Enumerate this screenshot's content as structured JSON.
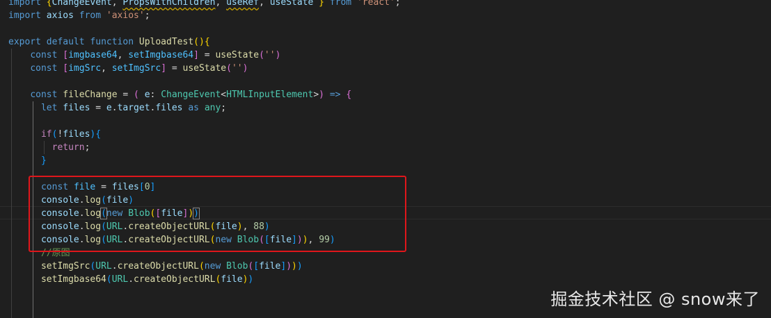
{
  "colors": {
    "background": "#1f1f1f",
    "keyword": "#569cd6",
    "control_keyword": "#c586c0",
    "function": "#dcdcaa",
    "variable": "#9cdcfe",
    "constant": "#4fc1ff",
    "type": "#4ec9b0",
    "string": "#ce9178",
    "number": "#b5cea8",
    "comment": "#6a9955",
    "annotation_box": "#e0161b"
  },
  "editor": {
    "lines": [
      [
        [
          "kw",
          "import"
        ],
        [
          "pl",
          " "
        ],
        [
          "b1",
          "{"
        ],
        [
          "var",
          "ChangeEvent"
        ],
        [
          "pl",
          ", "
        ],
        [
          "var squig",
          "PropsWithChildren"
        ],
        [
          "pl",
          ", "
        ],
        [
          "var squig",
          "useRef"
        ],
        [
          "pl",
          ", "
        ],
        [
          "var",
          "useState"
        ],
        [
          "pl",
          " "
        ],
        [
          "b1",
          "}"
        ],
        [
          "pl",
          " "
        ],
        [
          "kw",
          "from"
        ],
        [
          "pl",
          " "
        ],
        [
          "str",
          "'react'"
        ],
        [
          "pl",
          ";"
        ]
      ],
      [
        [
          "kw",
          "import"
        ],
        [
          "pl",
          " "
        ],
        [
          "var",
          "axios"
        ],
        [
          "pl",
          " "
        ],
        [
          "kw",
          "from"
        ],
        [
          "pl",
          " "
        ],
        [
          "str",
          "'axios'"
        ],
        [
          "pl",
          ";"
        ]
      ],
      [],
      [
        [
          "kw",
          "export"
        ],
        [
          "pl",
          " "
        ],
        [
          "kw",
          "default"
        ],
        [
          "pl",
          " "
        ],
        [
          "kw",
          "function"
        ],
        [
          "pl",
          " "
        ],
        [
          "fn",
          "UploadTest"
        ],
        [
          "b1",
          "()"
        ],
        [
          "b1",
          "{"
        ]
      ],
      [
        [
          "pl",
          "    "
        ],
        [
          "kw",
          "const"
        ],
        [
          "pl",
          " "
        ],
        [
          "b2",
          "["
        ],
        [
          "const",
          "imgbase64"
        ],
        [
          "pl",
          ", "
        ],
        [
          "const",
          "setImgbase64"
        ],
        [
          "b2",
          "]"
        ],
        [
          "pl",
          " = "
        ],
        [
          "fn",
          "useState"
        ],
        [
          "b2",
          "("
        ],
        [
          "str",
          "''"
        ],
        [
          "b2",
          ")"
        ]
      ],
      [
        [
          "pl",
          "    "
        ],
        [
          "kw",
          "const"
        ],
        [
          "pl",
          " "
        ],
        [
          "b2",
          "["
        ],
        [
          "const",
          "imgSrc"
        ],
        [
          "pl",
          ", "
        ],
        [
          "const",
          "setImgSrc"
        ],
        [
          "b2",
          "]"
        ],
        [
          "pl",
          " = "
        ],
        [
          "fn",
          "useState"
        ],
        [
          "b2",
          "("
        ],
        [
          "str",
          "''"
        ],
        [
          "b2",
          ")"
        ]
      ],
      [],
      [
        [
          "pl",
          "    "
        ],
        [
          "kw",
          "const"
        ],
        [
          "pl",
          " "
        ],
        [
          "fn",
          "fileChange"
        ],
        [
          "pl",
          " = "
        ],
        [
          "b2",
          "("
        ],
        [
          "pl",
          " "
        ],
        [
          "var",
          "e"
        ],
        [
          "pl",
          ": "
        ],
        [
          "type",
          "ChangeEvent"
        ],
        [
          "pl",
          "<"
        ],
        [
          "type",
          "HTMLInputElement"
        ],
        [
          "pl",
          ">"
        ],
        [
          "b2",
          ")"
        ],
        [
          "pl",
          " "
        ],
        [
          "kw",
          "=>"
        ],
        [
          "pl",
          " "
        ],
        [
          "b2",
          "{"
        ]
      ],
      [
        [
          "pl",
          "      "
        ],
        [
          "kw",
          "let"
        ],
        [
          "pl",
          " "
        ],
        [
          "var",
          "files"
        ],
        [
          "pl",
          " = "
        ],
        [
          "var",
          "e"
        ],
        [
          "pl",
          "."
        ],
        [
          "var",
          "target"
        ],
        [
          "pl",
          "."
        ],
        [
          "var",
          "files"
        ],
        [
          "pl",
          " "
        ],
        [
          "kw",
          "as"
        ],
        [
          "pl",
          " "
        ],
        [
          "type",
          "any"
        ],
        [
          "pl",
          ";"
        ]
      ],
      [],
      [
        [
          "pl",
          "      "
        ],
        [
          "ctl",
          "if"
        ],
        [
          "b3",
          "("
        ],
        [
          "pl",
          "!"
        ],
        [
          "var",
          "files"
        ],
        [
          "b3",
          ")"
        ],
        [
          "b3",
          "{"
        ]
      ],
      [
        [
          "pl",
          "        "
        ],
        [
          "ctl",
          "return"
        ],
        [
          "pl",
          ";"
        ]
      ],
      [
        [
          "pl",
          "      "
        ],
        [
          "b3",
          "}"
        ]
      ],
      [],
      [
        [
          "pl",
          "      "
        ],
        [
          "kw",
          "const"
        ],
        [
          "pl",
          " "
        ],
        [
          "const",
          "file"
        ],
        [
          "pl",
          " = "
        ],
        [
          "var",
          "files"
        ],
        [
          "b3",
          "["
        ],
        [
          "num",
          "0"
        ],
        [
          "b3",
          "]"
        ]
      ],
      [
        [
          "pl",
          "      "
        ],
        [
          "var",
          "console"
        ],
        [
          "pl",
          "."
        ],
        [
          "fn",
          "log"
        ],
        [
          "b3",
          "("
        ],
        [
          "var",
          "file"
        ],
        [
          "b3",
          ")"
        ]
      ],
      [
        [
          "pl",
          "      "
        ],
        [
          "var",
          "console"
        ],
        [
          "pl",
          "."
        ],
        [
          "fn",
          "log"
        ],
        [
          "b3 cursor-box",
          "("
        ],
        [
          "kw",
          "new"
        ],
        [
          "pl",
          " "
        ],
        [
          "type",
          "Blob"
        ],
        [
          "b1",
          "("
        ],
        [
          "b2",
          "["
        ],
        [
          "var",
          "file"
        ],
        [
          "b2",
          "]"
        ],
        [
          "b1",
          ")"
        ],
        [
          "b3 cursor-box",
          ")"
        ]
      ],
      [
        [
          "pl",
          "      "
        ],
        [
          "var",
          "console"
        ],
        [
          "pl",
          "."
        ],
        [
          "fn",
          "log"
        ],
        [
          "b3",
          "("
        ],
        [
          "type",
          "URL"
        ],
        [
          "pl",
          "."
        ],
        [
          "fn",
          "createObjectURL"
        ],
        [
          "b1",
          "("
        ],
        [
          "var",
          "file"
        ],
        [
          "b1",
          ")"
        ],
        [
          "pl",
          ", "
        ],
        [
          "num",
          "88"
        ],
        [
          "b3",
          ")"
        ]
      ],
      [
        [
          "pl",
          "      "
        ],
        [
          "var",
          "console"
        ],
        [
          "pl",
          "."
        ],
        [
          "fn",
          "log"
        ],
        [
          "b3",
          "("
        ],
        [
          "type",
          "URL"
        ],
        [
          "pl",
          "."
        ],
        [
          "fn",
          "createObjectURL"
        ],
        [
          "b1",
          "("
        ],
        [
          "kw",
          "new"
        ],
        [
          "pl",
          " "
        ],
        [
          "type",
          "Blob"
        ],
        [
          "b2",
          "("
        ],
        [
          "b3",
          "["
        ],
        [
          "var",
          "file"
        ],
        [
          "b3",
          "]"
        ],
        [
          "b2",
          ")"
        ],
        [
          "b1",
          ")"
        ],
        [
          "pl",
          ", "
        ],
        [
          "num",
          "99"
        ],
        [
          "b3",
          ")"
        ]
      ],
      [
        [
          "pl",
          "      "
        ],
        [
          "cmt",
          "//原图"
        ]
      ],
      [
        [
          "pl",
          "      "
        ],
        [
          "fn",
          "setImgSrc"
        ],
        [
          "b3",
          "("
        ],
        [
          "type",
          "URL"
        ],
        [
          "pl",
          "."
        ],
        [
          "fn",
          "createObjectURL"
        ],
        [
          "b1",
          "("
        ],
        [
          "kw",
          "new"
        ],
        [
          "pl",
          " "
        ],
        [
          "type",
          "Blob"
        ],
        [
          "b2",
          "("
        ],
        [
          "b3",
          "["
        ],
        [
          "var",
          "file"
        ],
        [
          "b3",
          "]"
        ],
        [
          "b2",
          ")"
        ],
        [
          "b1",
          ")"
        ],
        [
          "b3",
          ")"
        ]
      ],
      [
        [
          "pl",
          "      "
        ],
        [
          "fn",
          "setImgbase64"
        ],
        [
          "b3",
          "("
        ],
        [
          "type",
          "URL"
        ],
        [
          "pl",
          "."
        ],
        [
          "fn",
          "createObjectURL"
        ],
        [
          "b1",
          "("
        ],
        [
          "var",
          "file"
        ],
        [
          "b1",
          ")"
        ],
        [
          "b3",
          ")"
        ]
      ],
      [],
      []
    ]
  },
  "watermark": {
    "text": "掘金技术社区 @ snow来了"
  }
}
